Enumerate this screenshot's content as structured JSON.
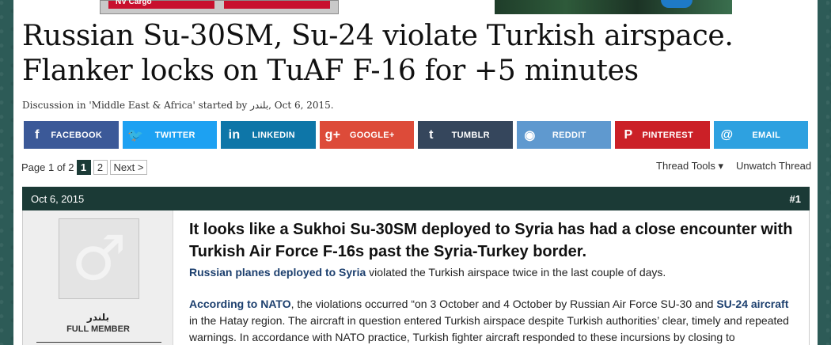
{
  "ads": {
    "left_label": "NV Cargo"
  },
  "thread": {
    "title": "Russian Su-30SM, Su-24 violate Turkish airspace. Flanker locks on TuAF F-16 for +5 minutes",
    "meta": "Discussion in 'Middle East & Africa' started by بلندر, Oct 6, 2015."
  },
  "share": [
    {
      "name": "facebook",
      "label": "FACEBOOK",
      "icon": "f",
      "color": "#3b5998"
    },
    {
      "name": "twitter",
      "label": "TWITTER",
      "icon": "🐦",
      "color": "#1da1f2"
    },
    {
      "name": "linkedin",
      "label": "LINKEDIN",
      "icon": "in",
      "color": "#0e76a8"
    },
    {
      "name": "googleplus",
      "label": "GOOGLE+",
      "icon": "g+",
      "color": "#dd4b39"
    },
    {
      "name": "tumblr",
      "label": "TUMBLR",
      "icon": "t",
      "color": "#35465c"
    },
    {
      "name": "reddit",
      "label": "REDDIT",
      "icon": "◉",
      "color": "#5f99cf"
    },
    {
      "name": "pinterest",
      "label": "PINTEREST",
      "icon": "P",
      "color": "#cb2027"
    },
    {
      "name": "email",
      "label": "EMAIL",
      "icon": "@",
      "color": "#2ea1e0"
    }
  ],
  "pager": {
    "label": "Page 1 of 2",
    "pages": [
      "1",
      "2"
    ],
    "current": "1",
    "next": "Next >"
  },
  "tools": {
    "thread_tools": "Thread Tools ▾",
    "unwatch": "Unwatch Thread"
  },
  "post": {
    "date": "Oct 6, 2015",
    "number": "#1",
    "user": {
      "name": "بلندر",
      "rank": "FULL MEMBER"
    },
    "heading": "It looks like a Sukhoi Su-30SM deployed to Syria has had a close encounter with Turkish Air Force F-16s past the Syria-Turkey border.",
    "p1_link": "Russian planes deployed to Syria",
    "p1_rest": " violated the Turkish airspace twice in the last couple of days.",
    "p2_link1": "According to NATO",
    "p2_mid": ", the violations occurred “on 3 October and 4 October by Russian Air Force SU-30 and ",
    "p2_link2": "SU-24 aircraft",
    "p2_rest": " in the Hatay region. The aircraft in question entered Turkish airspace despite Turkish authorities’ clear, timely and repeated warnings. In accordance with NATO practice, Turkish fighter aircraft responded to these incursions by closing to"
  }
}
